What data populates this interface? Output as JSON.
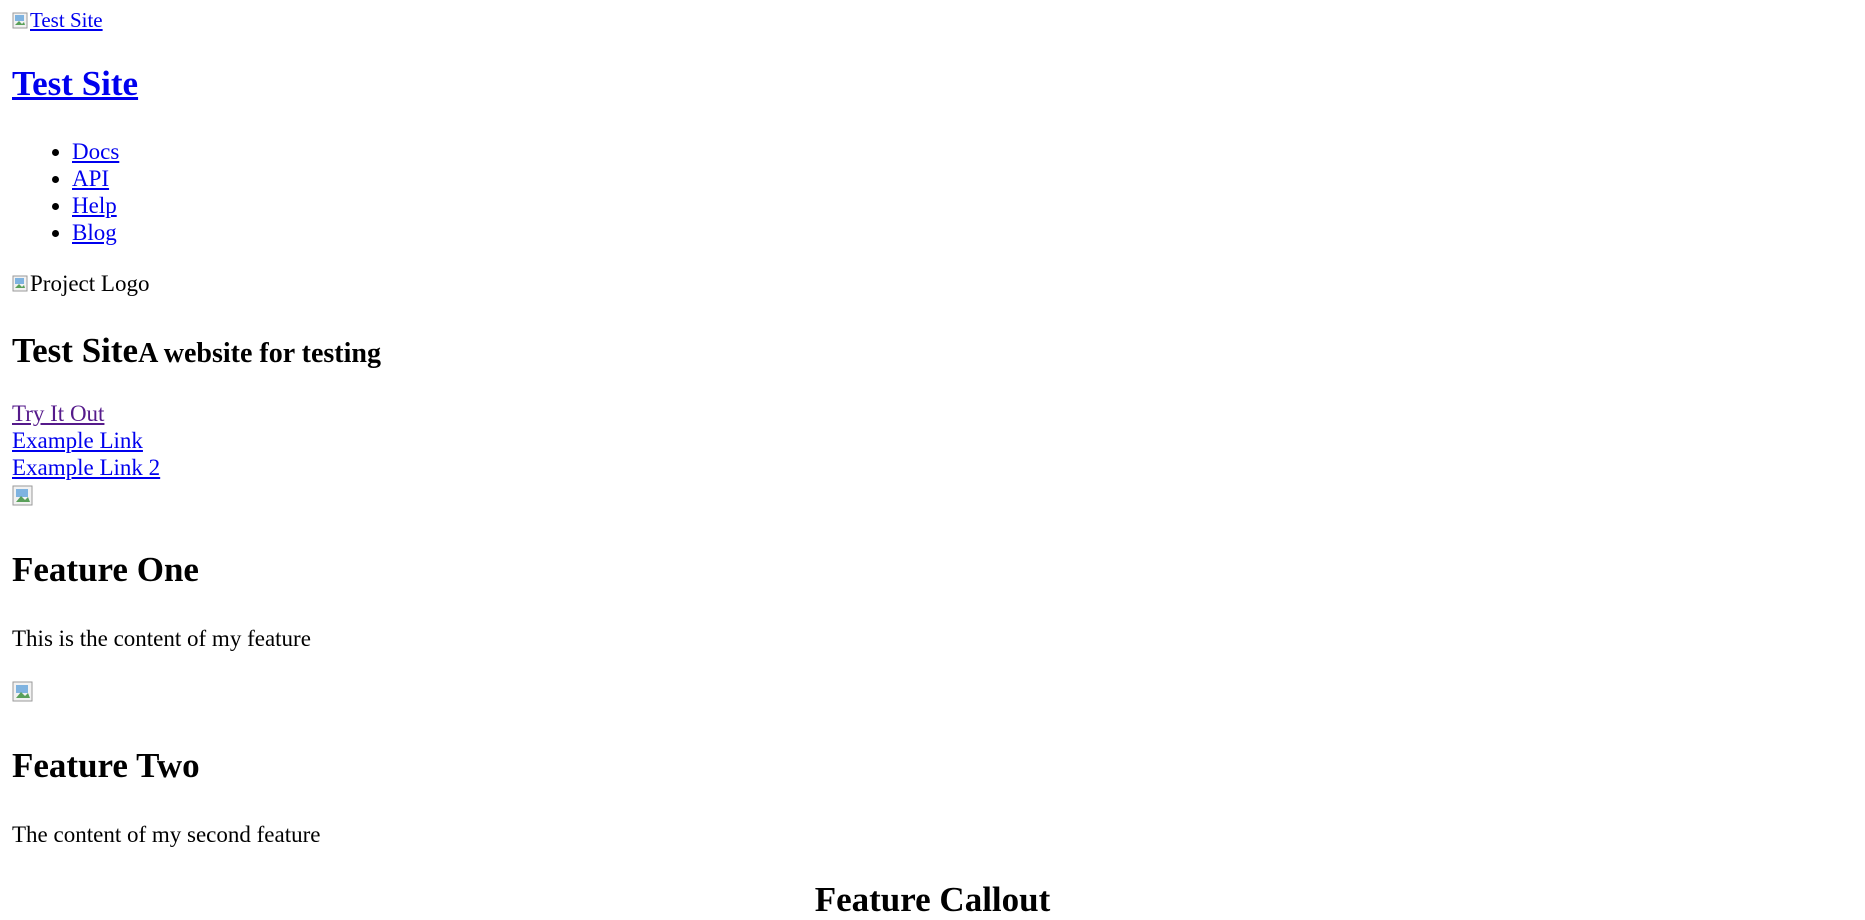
{
  "header": {
    "logo_alt": "Test Site",
    "title": "Test Site"
  },
  "nav": {
    "items": [
      {
        "label": "Docs"
      },
      {
        "label": "API"
      },
      {
        "label": "Help"
      },
      {
        "label": "Blog"
      }
    ]
  },
  "hero": {
    "logo_alt": "Project Logo",
    "title": "Test Site",
    "tagline": "A website for testing",
    "links": {
      "try_it_out": "Try It Out",
      "example_link": "Example Link",
      "example_link_2": "Example Link 2"
    }
  },
  "features": [
    {
      "title": "Feature One",
      "content": "This is the content of my feature",
      "icon": "broken-image-icon"
    },
    {
      "title": "Feature Two",
      "content": "The content of my second feature",
      "icon": "broken-image-icon"
    }
  ],
  "callout": {
    "title": "Feature Callout"
  },
  "colors": {
    "link": "#0000ee",
    "visited_link": "#551a8b",
    "background": "#ffffff",
    "text": "#000000"
  }
}
